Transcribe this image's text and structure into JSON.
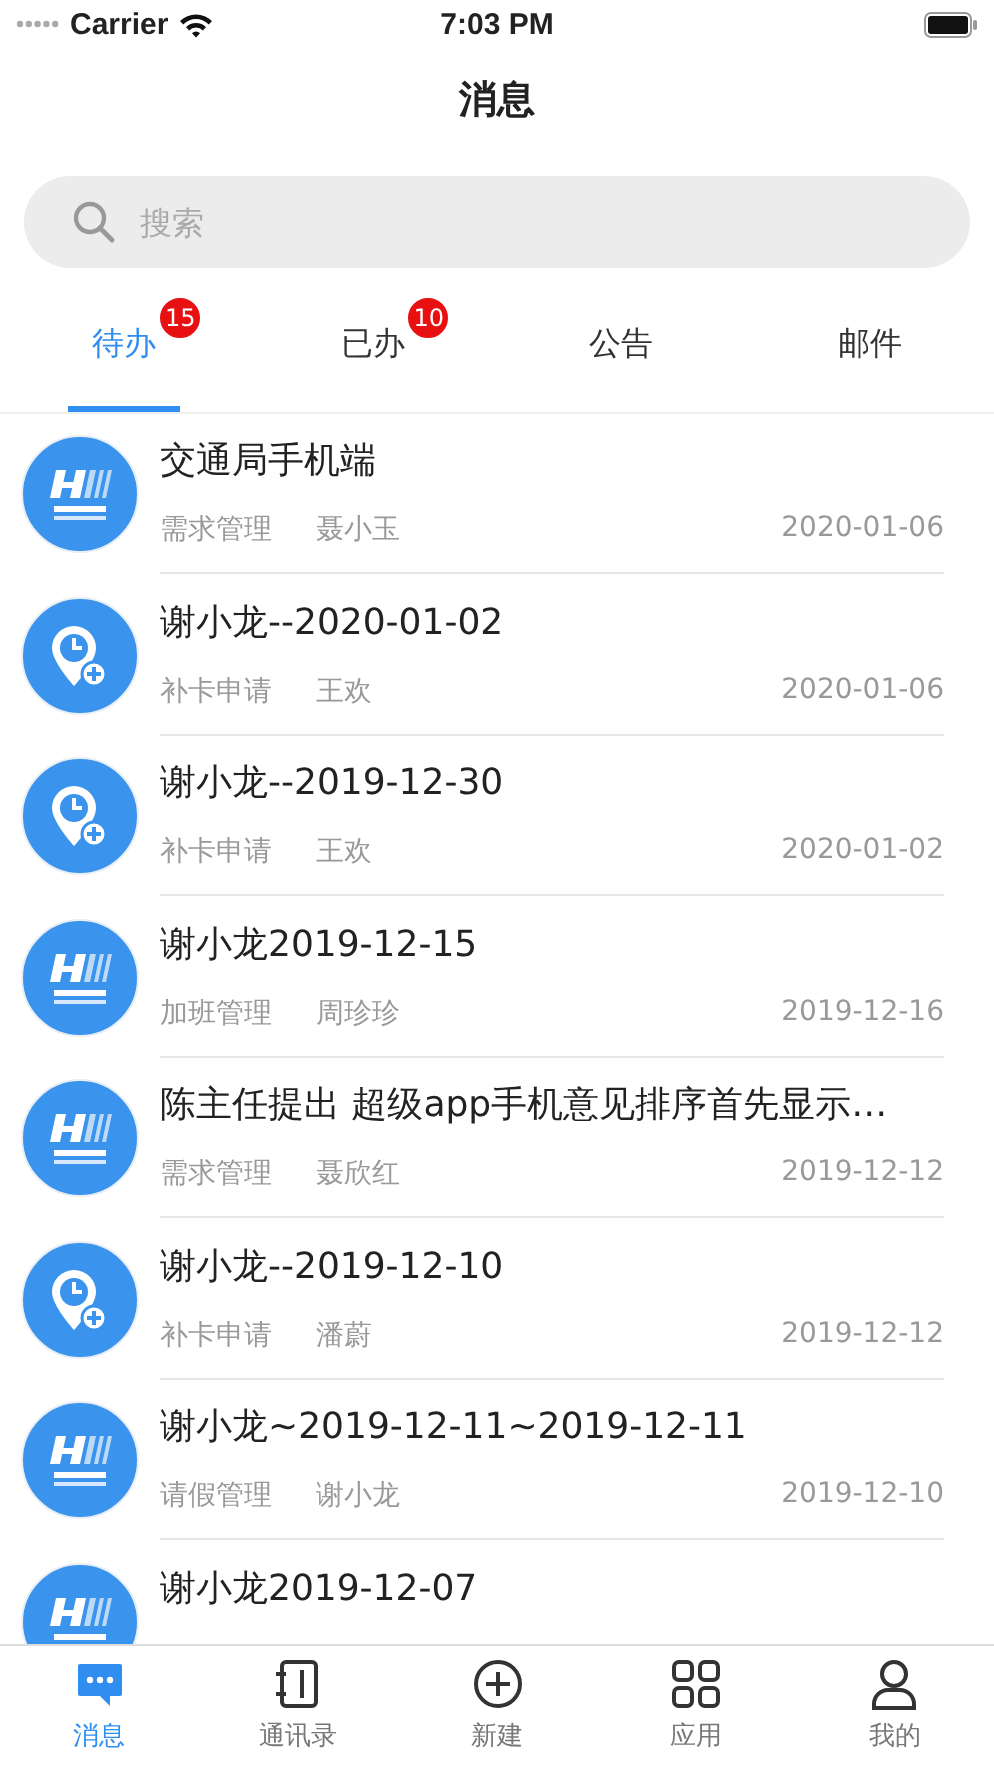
{
  "status_bar": {
    "carrier": "Carrier",
    "time": "7:03 PM"
  },
  "header": {
    "title": "消息"
  },
  "search": {
    "placeholder": "搜索"
  },
  "tabs": [
    {
      "label": "待办",
      "badge": "15",
      "selected": true
    },
    {
      "label": "已办",
      "badge": "10",
      "selected": false
    },
    {
      "label": "公告",
      "selected": false
    },
    {
      "label": "邮件",
      "selected": false
    }
  ],
  "messages": [
    {
      "kind": "logo",
      "title": "交通局手机端",
      "category": "需求管理",
      "person": "聂小玉",
      "date": "2020-01-06"
    },
    {
      "kind": "clock",
      "title": "谢小龙--2020-01-02",
      "category": "补卡申请",
      "person": "王欢",
      "date": "2020-01-06"
    },
    {
      "kind": "clock",
      "title": "谢小龙--2019-12-30",
      "category": "补卡申请",
      "person": "王欢",
      "date": "2020-01-02"
    },
    {
      "kind": "logo",
      "title": "谢小龙2019-12-15",
      "category": "加班管理",
      "person": "周珍珍",
      "date": "2019-12-16"
    },
    {
      "kind": "logo",
      "title": "陈主任提出 超级app手机意见排序首先显示…",
      "category": "需求管理",
      "person": "聂欣红",
      "date": "2019-12-12"
    },
    {
      "kind": "clock",
      "title": "谢小龙--2019-12-10",
      "category": "补卡申请",
      "person": "潘蔚",
      "date": "2019-12-12"
    },
    {
      "kind": "logo",
      "title": "谢小龙~2019-12-11~2019-12-11",
      "category": "请假管理",
      "person": "谢小龙",
      "date": "2019-12-10"
    },
    {
      "kind": "logo",
      "title": "谢小龙2019-12-07"
    }
  ],
  "tab_bar": [
    {
      "kind": "chat",
      "label": "消息",
      "selected": true
    },
    {
      "kind": "book",
      "label": "通讯录",
      "selected": false
    },
    {
      "kind": "plus",
      "label": "新建",
      "selected": false
    },
    {
      "kind": "grid",
      "label": "应用",
      "selected": false
    },
    {
      "kind": "person",
      "label": "我的",
      "selected": false
    }
  ]
}
